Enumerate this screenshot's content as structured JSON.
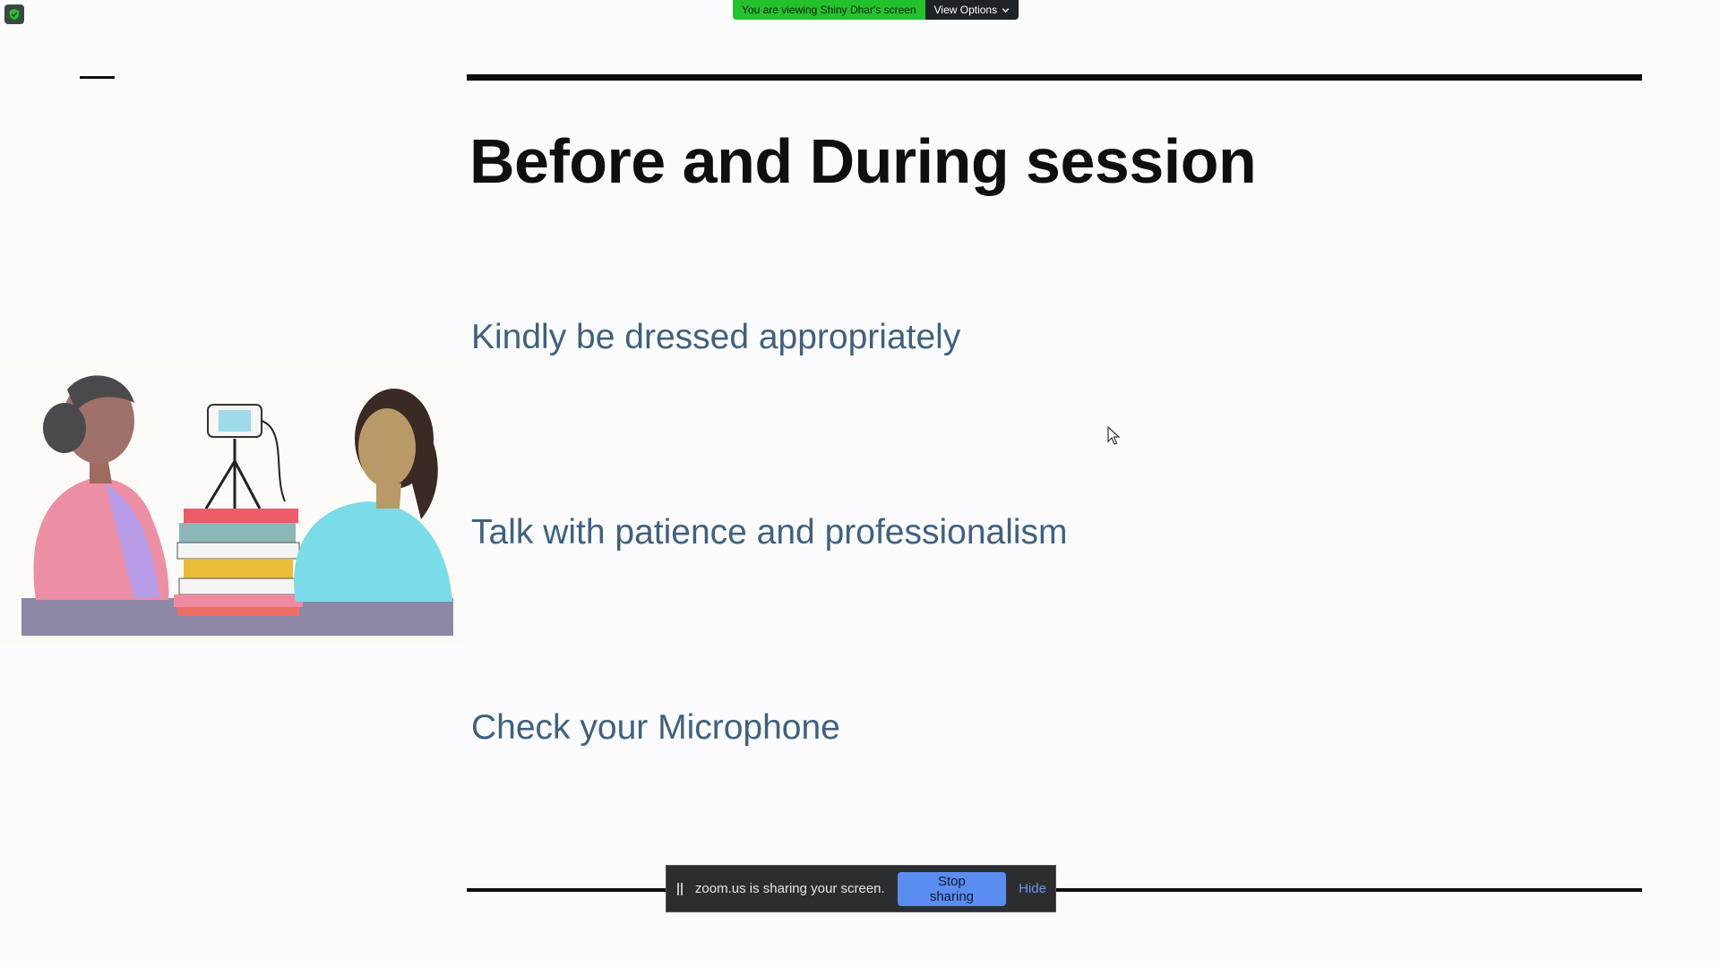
{
  "banner": {
    "viewing_text": "You are viewing Shiny Dhar's screen",
    "view_options_label": "View Options",
    "badge_icon": "shield-check-icon",
    "badge_color": "#23c22d"
  },
  "slide": {
    "title": "Before and During session",
    "bullets": [
      "Kindly be dressed appropriately",
      "Talk with patience and professionalism",
      "Check your Microphone"
    ],
    "text_color": "#3f6180",
    "illustration": "two-women-video-call-illustration"
  },
  "share_bar": {
    "message": "zoom.us is sharing your screen.",
    "stop_label": "Stop sharing",
    "hide_label": "Hide",
    "button_color": "#5b8cf0"
  }
}
